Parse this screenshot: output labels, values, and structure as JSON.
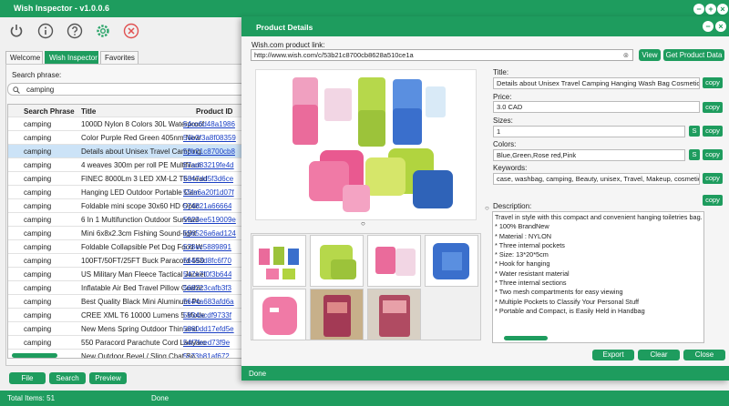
{
  "app": {
    "title": "Wish Inspector - v1.0.0.6"
  },
  "toolbar": {
    "icons": [
      "power-icon",
      "info-icon",
      "help-icon",
      "settings-icon",
      "close-icon"
    ]
  },
  "tabs": [
    {
      "label": "Welcome"
    },
    {
      "label": "Wish Inspector"
    },
    {
      "label": "Favorites"
    }
  ],
  "search": {
    "label": "Search phrase:",
    "value": "camping"
  },
  "grid": {
    "headers": [
      "Search Phrase",
      "Title",
      "Product ID"
    ],
    "rows": [
      {
        "phrase": "camping",
        "title": "1000D Nylon 8 Colors 30L Waterproof",
        "id": "54cc6d48a1986"
      },
      {
        "phrase": "camping",
        "title": "Color Purple Red Green 405nm New",
        "id": "56b2f3a8f08359"
      },
      {
        "phrase": "camping",
        "title": "Details about  Unisex Travel Camping",
        "id": "53b21c8700cb8"
      },
      {
        "phrase": "camping",
        "title": "4 weaves 300m per roll  PE Multifilam",
        "id": "57ad83219fe4d"
      },
      {
        "phrase": "camping",
        "title": "FINEC 8000Lm 3 LED XM-L2 T6 Head",
        "id": "5847dd5f3d6ce"
      },
      {
        "phrase": "camping",
        "title": "Hanging LED Outdoor Portable  Cam",
        "id": "55fa6a20f1d07f"
      },
      {
        "phrase": "camping",
        "title": "Foldable mini scope 30x60 HD Optic",
        "id": "574821a66664"
      },
      {
        "phrase": "camping",
        "title": "6 In 1 Multifunction Outdoor Survival",
        "id": "5923ee519009e"
      },
      {
        "phrase": "camping",
        "title": "Mini 6x8x2.3cm Fishing Sound-light",
        "id": "556526a6ad124"
      },
      {
        "phrase": "camping",
        "title": "Foldable Collapsible Pet Dog Food W",
        "id": "578ec5889891"
      },
      {
        "phrase": "camping",
        "title": "100FT/50FT/25FT  Buck Paracord 550",
        "id": "56493d8fc6f70"
      },
      {
        "phrase": "camping",
        "title": "US Military Man Fleece Tactical Jacket",
        "id": "547e7f0f3b644"
      },
      {
        "phrase": "camping",
        "title": "Inflatable Air Bed Travel Pillow Cushic",
        "id": "568223cafb3f3"
      },
      {
        "phrase": "camping",
        "title": "Best Quality Black Mini Aluminum Po",
        "id": "5644a683afd6a"
      },
      {
        "phrase": "camping",
        "title": "CREE XML T6 10000 Lumens 5 Mode",
        "id": "5834acdf9733f"
      },
      {
        "phrase": "camping",
        "title": "New Mens Spring Outdoor Thin and",
        "id": "5860dd17efd5e"
      },
      {
        "phrase": "camping",
        "title": "550 Paracord Parachute Cord Lanyarc",
        "id": "54f7feed73f9e"
      },
      {
        "phrase": "camping",
        "title": "New Outdoor Bevel / Sling Chat So",
        "id": "5c73b81af672"
      }
    ]
  },
  "bottom_buttons": {
    "file": "File",
    "search": "Search",
    "preview": "Preview"
  },
  "status": {
    "total": "Total Items: 51",
    "state": "Done"
  },
  "dialog": {
    "title": "Product Details",
    "url_label": "Wish.com product link:",
    "url": "http://www.wish.com/c/53b21c8700cb8628a510ce1a",
    "view": "View",
    "get_data": "Get Product Data",
    "title_label": "Title:",
    "title_value": "Details about  Unisex Travel Camping Hanging Wash Bag Cosmetic",
    "price_label": "Price:",
    "price_value": "3.0 CAD",
    "sizes_label": "Sizes:",
    "sizes_value": "1",
    "colors_label": "Colors:",
    "colors_value": "Blue,Green,Rose red,Pink",
    "keywords_label": "Keywords:",
    "keywords_value": "case, washbag, camping, Beauty, unisex, Travel, Makeup, cosmetic, l",
    "copy": "copy",
    "s": "S",
    "description_label": "Description:",
    "description": [
      "Travel in style with this compact and convenient hanging toiletries bag. It is a",
      "* 100% BrandNew",
      "* Material : NYLON",
      "* Three internal pockets",
      "* Size: 13*20*5cm",
      "* Hook for hanging",
      "* Water resistant material",
      "* Three internal sections",
      "* Two mesh compartments for easy viewing",
      "* Multiple Pockets to Classify Your Personal Stuff",
      "* Portable and Compact, is Easily Held in Handbag"
    ],
    "export": "Export",
    "clear": "Clear",
    "close": "Close",
    "status": "Done"
  },
  "colors": {
    "accent": "#1e9c5e",
    "link": "#1a3fc4",
    "selected": "#cce3f7"
  }
}
